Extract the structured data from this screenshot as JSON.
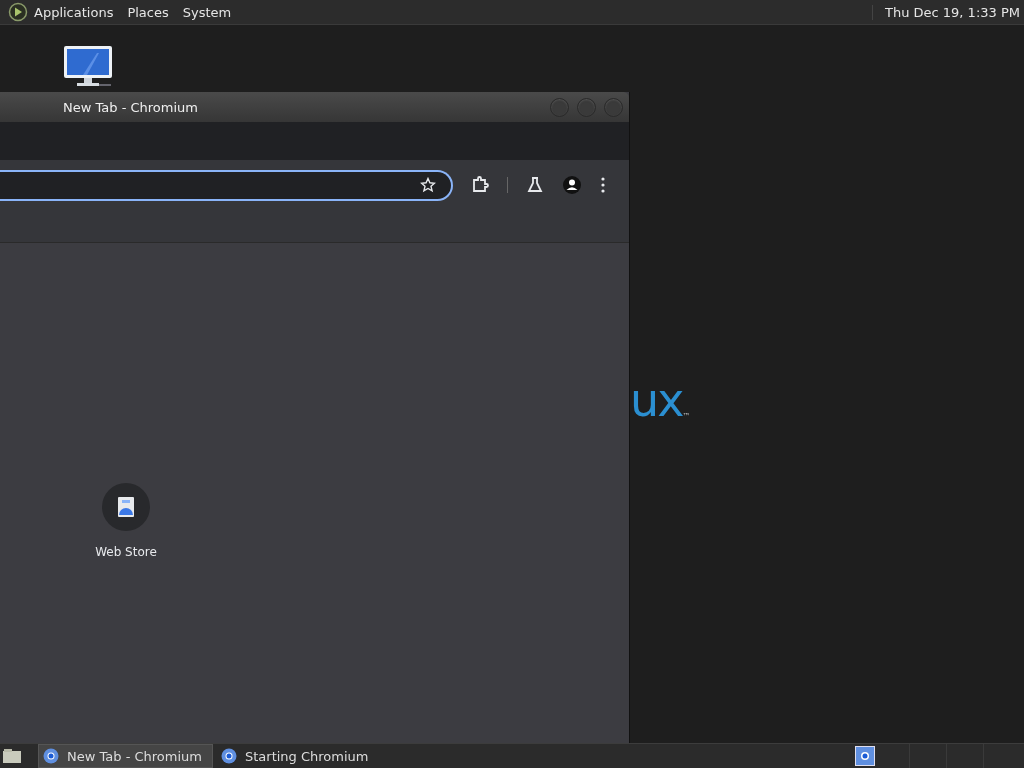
{
  "top_panel": {
    "menus": [
      "Applications",
      "Places",
      "System"
    ],
    "clock": "Thu Dec 19, 1:33 PM"
  },
  "desktop": {
    "logo_text": "ux",
    "logo_mark": "™"
  },
  "window": {
    "title": "New Tab - Chromium",
    "shortcuts": [
      {
        "label": "Web Store"
      }
    ]
  },
  "taskbar": {
    "tasks": [
      {
        "label": "New Tab - Chromium",
        "selected": true
      },
      {
        "label": "Starting Chromium",
        "selected": false
      }
    ]
  }
}
